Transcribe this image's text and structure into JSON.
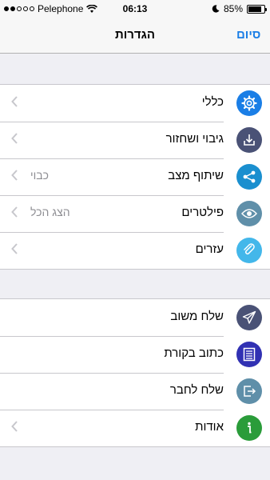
{
  "status_bar": {
    "carrier": "Pelephone",
    "time": "06:13",
    "battery": "85%",
    "battery_level": 0.85,
    "signal_bars_filled": 2,
    "signal_bars_total": 5
  },
  "nav": {
    "title": "הגדרות",
    "done_label": "סיום"
  },
  "settings_group_1": [
    {
      "name": "general",
      "label": "כללי",
      "value": "",
      "icon": "gear-icon",
      "color": "#1a7ee6",
      "chevron": true
    },
    {
      "name": "backup",
      "label": "גיבוי ושחזור",
      "value": "",
      "icon": "download-icon",
      "color": "#4a5276",
      "chevron": true
    },
    {
      "name": "share-status",
      "label": "שיתוף מצב",
      "value": "כבוי",
      "icon": "share-icon",
      "color": "#1a8fcf",
      "chevron": true
    },
    {
      "name": "filters",
      "label": "פילטרים",
      "value": "הצג הכל",
      "icon": "eye-icon",
      "color": "#5f8fa9",
      "chevron": true
    },
    {
      "name": "helpers",
      "label": "עזרים",
      "value": "",
      "icon": "paperclip-icon",
      "color": "#43b7ea",
      "chevron": true
    }
  ],
  "settings_group_2": [
    {
      "name": "send-feedback",
      "label": "שלח משוב",
      "value": "",
      "icon": "paper-plane-icon",
      "color": "#4a5276",
      "chevron": false
    },
    {
      "name": "write-review",
      "label": "כתוב בקורת",
      "value": "",
      "icon": "list-icon",
      "color": "#3131b3",
      "chevron": false
    },
    {
      "name": "send-to-friend",
      "label": "שלח לחבר",
      "value": "",
      "icon": "export-icon",
      "color": "#5f8fa9",
      "chevron": false
    },
    {
      "name": "about",
      "label": "אודות",
      "value": "",
      "icon": "info-icon",
      "color": "#2a9c3a",
      "chevron": true
    }
  ]
}
